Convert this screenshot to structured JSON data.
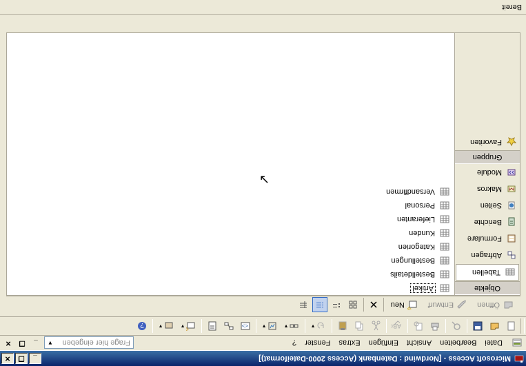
{
  "titlebar": {
    "title": "Microsoft Access - [Nordwind : Datenbank (Access 2000-Dateiformat)]"
  },
  "menu": {
    "datei": "Datei",
    "bearbeiten": "Bearbeiten",
    "ansicht": "Ansicht",
    "einfugen": "Einfügen",
    "extras": "Extras",
    "fenster": "Fenster",
    "help": "?",
    "helpbox": "Frage hier eingeben"
  },
  "innertb": {
    "offnen": "Öffnen",
    "entwurf": "Entwurf",
    "neu": "Neu"
  },
  "sidebar": {
    "objekte_header": "Objekte",
    "gruppen_header": "Gruppen",
    "items": [
      {
        "label": "Tabellen",
        "icon": "table-icon"
      },
      {
        "label": "Abfragen",
        "icon": "query-icon"
      },
      {
        "label": "Formulare",
        "icon": "form-icon"
      },
      {
        "label": "Berichte",
        "icon": "report-icon"
      },
      {
        "label": "Seiten",
        "icon": "page-icon"
      },
      {
        "label": "Makros",
        "icon": "macro-icon"
      },
      {
        "label": "Module",
        "icon": "module-icon"
      }
    ],
    "favoriten": "Favoriten"
  },
  "tables": [
    "Artikel",
    "Bestelldetails",
    "Bestellungen",
    "Kategorien",
    "Kunden",
    "Lieferanten",
    "Personal",
    "Versandfirmen"
  ],
  "status": {
    "text": "Bereit"
  }
}
